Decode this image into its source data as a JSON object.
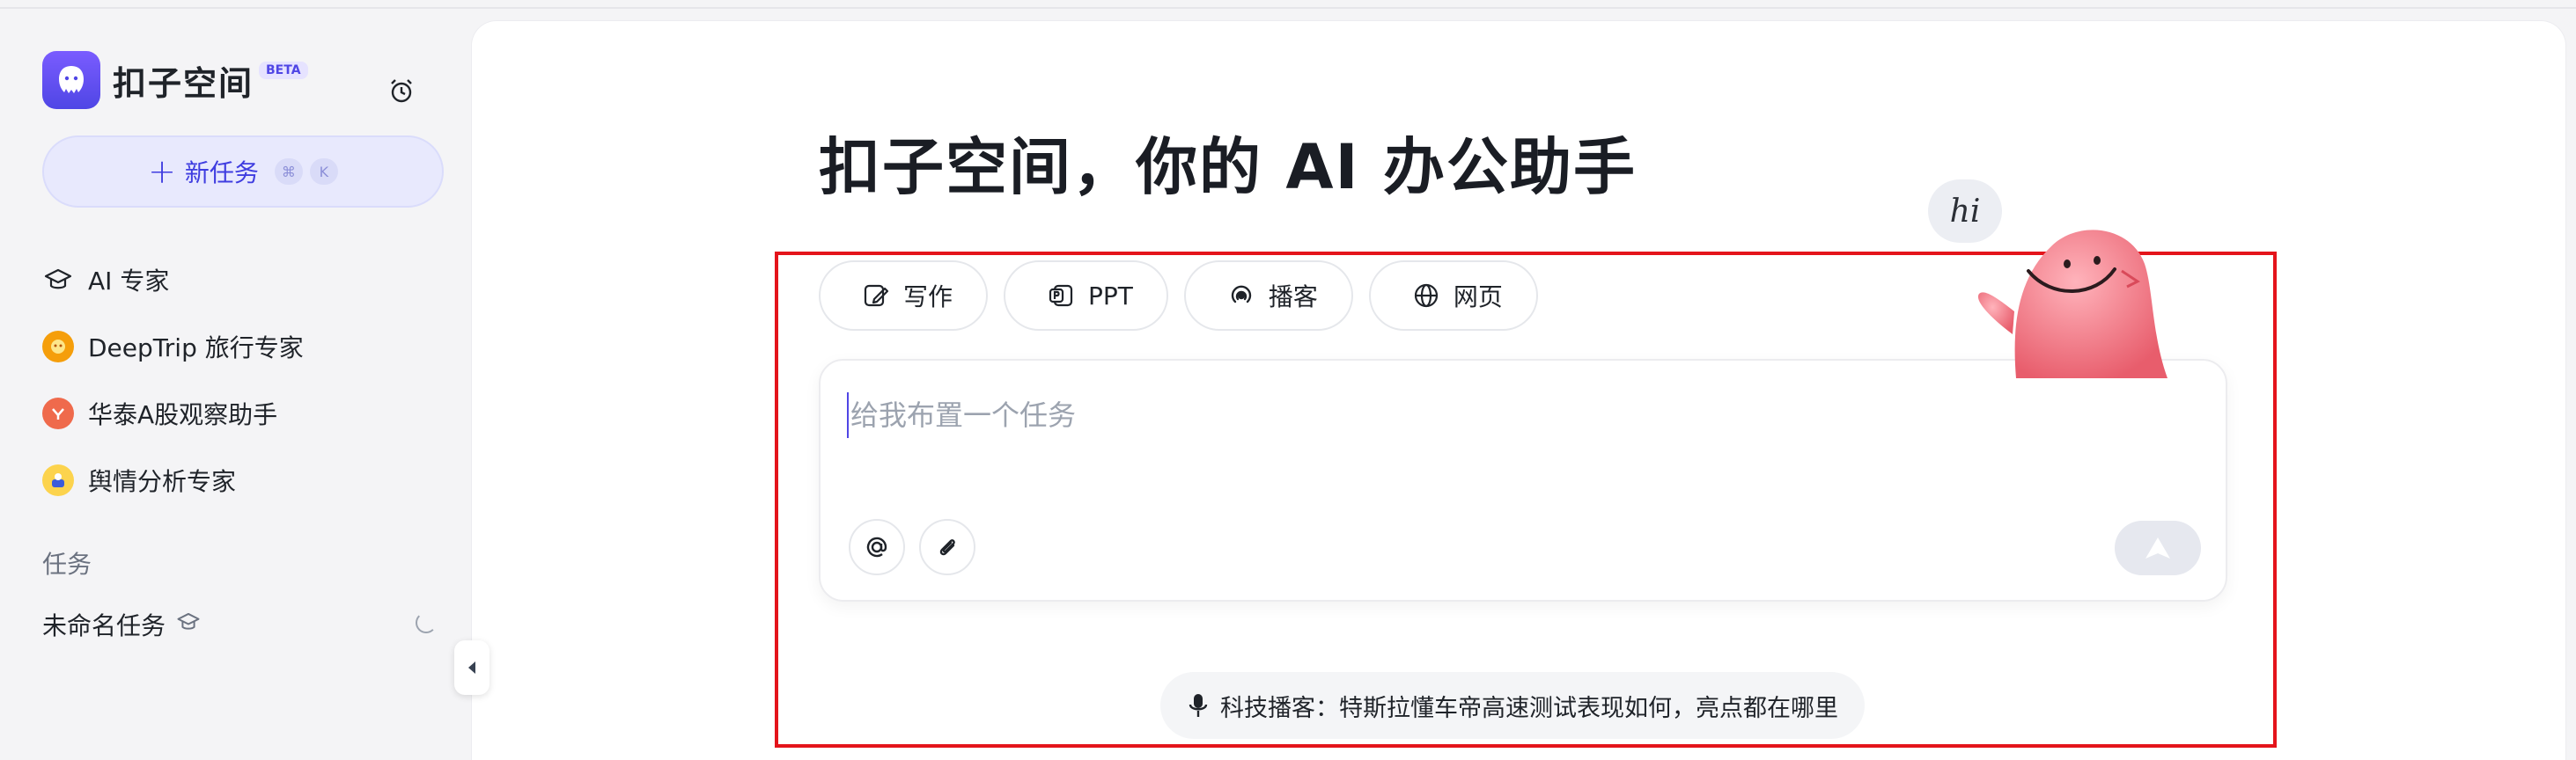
{
  "app": {
    "name": "扣子空间",
    "badge": "BETA"
  },
  "sidebar": {
    "new_task": {
      "label": "新任务",
      "shortcut_keys": [
        "⌘",
        "K"
      ]
    },
    "items": [
      {
        "label": "AI 专家",
        "icon": "graduation-cap-icon"
      },
      {
        "label": "DeepTrip 旅行专家",
        "icon": "deeptrip-avatar-icon"
      },
      {
        "label": "华泰A股观察助手",
        "icon": "huatai-avatar-icon"
      },
      {
        "label": "舆情分析专家",
        "icon": "sentiment-avatar-icon"
      }
    ],
    "section_label": "任务",
    "tasks": [
      {
        "label": "未命名任务",
        "icon": "graduation-cap-icon",
        "status": "loading"
      }
    ]
  },
  "main": {
    "headline": "扣子空间，你的 AI 办公助手",
    "greeting": "hi",
    "chips": [
      {
        "label": "写作",
        "icon": "write-icon"
      },
      {
        "label": "PPT",
        "icon": "ppt-icon"
      },
      {
        "label": "播客",
        "icon": "podcast-icon"
      },
      {
        "label": "网页",
        "icon": "globe-icon"
      }
    ],
    "input": {
      "placeholder": "给我布置一个任务",
      "value": ""
    },
    "suggestion": "科技播客：特斯拉懂车帝高速测试表现如何，亮点都在哪里"
  },
  "colors": {
    "accent": "#4f46e5",
    "new_task_bg": "#e8e9fd",
    "highlight_box": "#e4141b",
    "mascot": "#f07a86"
  }
}
